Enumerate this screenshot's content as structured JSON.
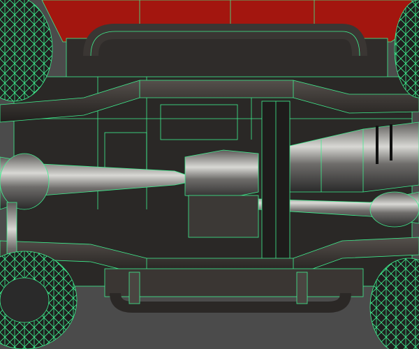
{
  "colors": {
    "background": "#4b4b4b",
    "body_red": "#a3160f",
    "chassis_dark": "#2a2826",
    "metal": "#8a8a86",
    "wireframe": "#3ff08f",
    "tire": "#1c1c1c"
  }
}
